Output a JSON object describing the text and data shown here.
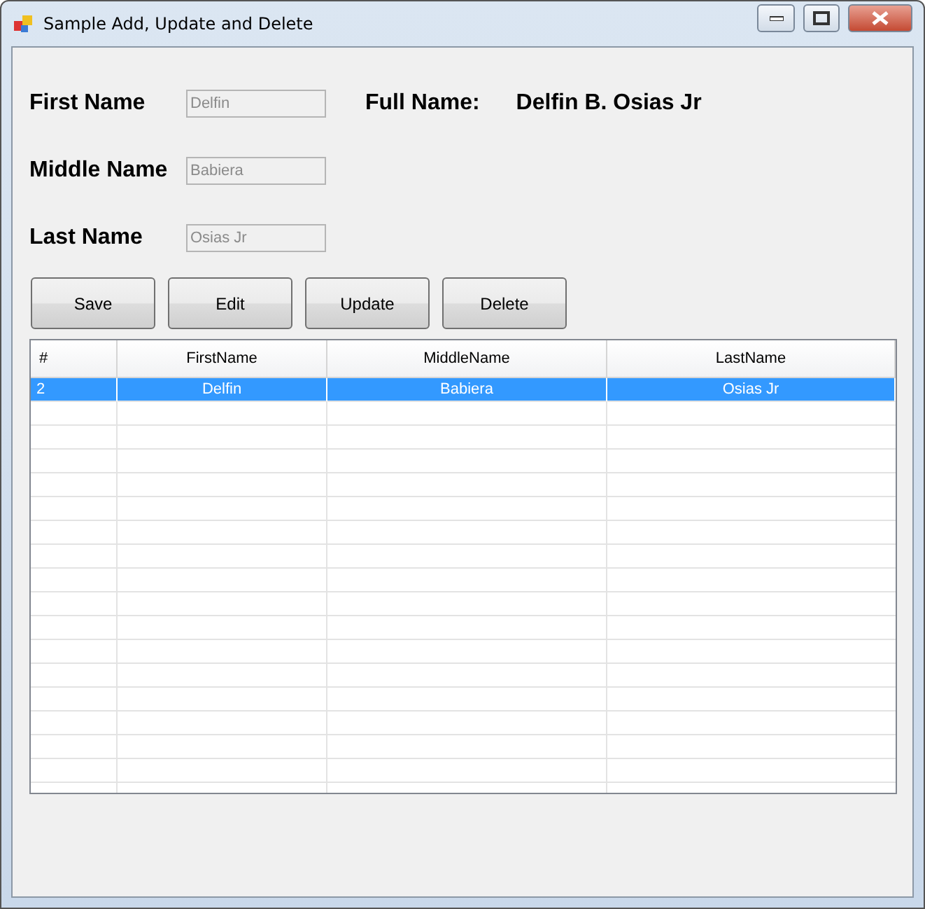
{
  "window": {
    "title": "Sample Add, Update and Delete"
  },
  "form": {
    "fields": [
      {
        "label": "First Name",
        "value": "Delfin",
        "disabled": true
      },
      {
        "label": "Middle Name",
        "value": "Babiera",
        "disabled": true
      },
      {
        "label": "Last Name",
        "value": "Osias Jr",
        "disabled": true
      }
    ],
    "full_name": {
      "label": "Full Name:",
      "value": "Delfin B. Osias Jr"
    }
  },
  "buttons": [
    "Save",
    "Edit",
    "Update",
    "Delete"
  ],
  "table": {
    "columns": [
      "#",
      "FirstName",
      "MiddleName",
      "LastName"
    ],
    "rows": [
      {
        "cells": [
          "2",
          "Delfin",
          "Babiera",
          "Osias Jr"
        ],
        "selected": true
      }
    ]
  }
}
